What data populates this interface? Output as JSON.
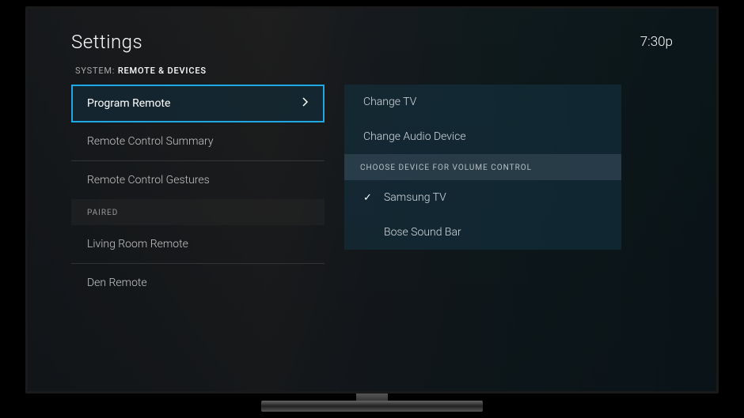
{
  "header": {
    "title": "Settings",
    "time": "7:30p"
  },
  "breadcrumb": {
    "parent": "SYSTEM:",
    "current": "REMOTE & DEVICES"
  },
  "leftMenu": {
    "items": [
      {
        "label": "Program Remote",
        "selected": true
      },
      {
        "label": "Remote Control Summary"
      },
      {
        "label": "Remote Control Gestures"
      }
    ],
    "pairedHeader": "PAIRED",
    "pairedItems": [
      {
        "label": "Living Room Remote"
      },
      {
        "label": "Den Remote"
      }
    ]
  },
  "rightPanel": {
    "items": [
      {
        "label": "Change TV"
      },
      {
        "label": "Change Audio Device"
      }
    ],
    "volumeHeader": "CHOOSE DEVICE FOR VOLUME CONTROL",
    "volumeDevices": [
      {
        "label": "Samsung TV",
        "checked": true
      },
      {
        "label": "Bose Sound Bar",
        "checked": false
      }
    ]
  }
}
